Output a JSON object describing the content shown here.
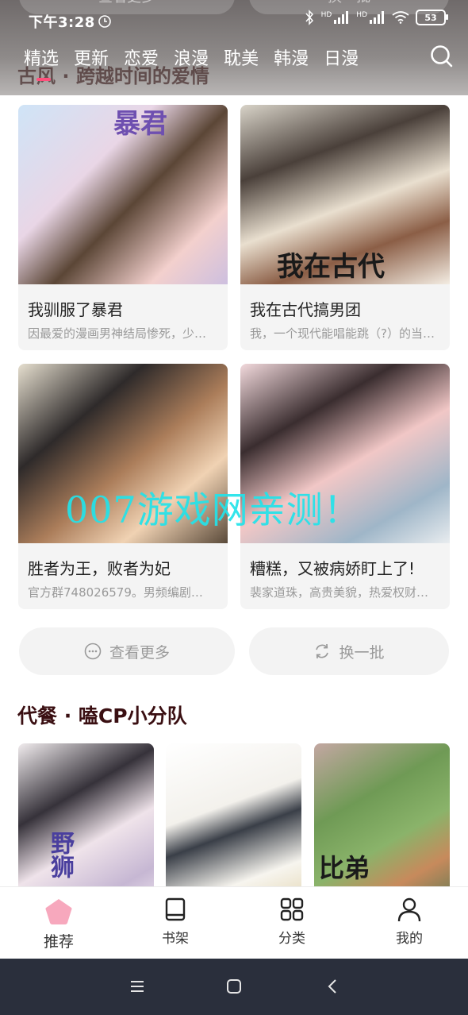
{
  "status_bar": {
    "time": "下午3:28",
    "network_1": "HD",
    "network_2": "HD",
    "battery": "53"
  },
  "top_ghost": {
    "more_label": "查看更多",
    "refresh_label": "换一批"
  },
  "category_tabs": [
    {
      "label": "精选"
    },
    {
      "label": "更新"
    },
    {
      "label": "恋爱"
    },
    {
      "label": "浪漫"
    },
    {
      "label": "耽美"
    },
    {
      "label": "韩漫"
    },
    {
      "label": "日漫"
    }
  ],
  "section1": {
    "title": "古风 · 跨越时间的爱情",
    "cards": [
      {
        "title": "我驯服了暴君",
        "desc": "因最爱的漫画男神结局惨死，少…",
        "cover_text": "暴君"
      },
      {
        "title": "我在古代搞男团",
        "desc": "我，一个现代能唱能跳（?）的当…",
        "cover_text": "我在古代"
      },
      {
        "title": "胜者为王，败者为妃",
        "desc": "官方群748026579。男频编剧…",
        "cover_text": ""
      },
      {
        "title": "糟糕，又被病娇盯上了!",
        "desc": "裴家道珠，高贵美貌，热爱权财…",
        "cover_text": ""
      }
    ],
    "more_label": "查看更多",
    "refresh_label": "换一批"
  },
  "watermark": "007游戏网亲测！",
  "section2": {
    "title": "代餐 · 嗑CP小分队",
    "cover_texts": [
      "野狮",
      "",
      "比弟"
    ]
  },
  "bottom_tabs": [
    {
      "label": "推荐",
      "icon": "home-icon"
    },
    {
      "label": "书架",
      "icon": "book-icon"
    },
    {
      "label": "分类",
      "icon": "grid-icon"
    },
    {
      "label": "我的",
      "icon": "user-icon"
    }
  ],
  "colors": {
    "accent": "#ff4f7b",
    "section_title": "#3a0f12",
    "watermark": "#22e3ea"
  }
}
